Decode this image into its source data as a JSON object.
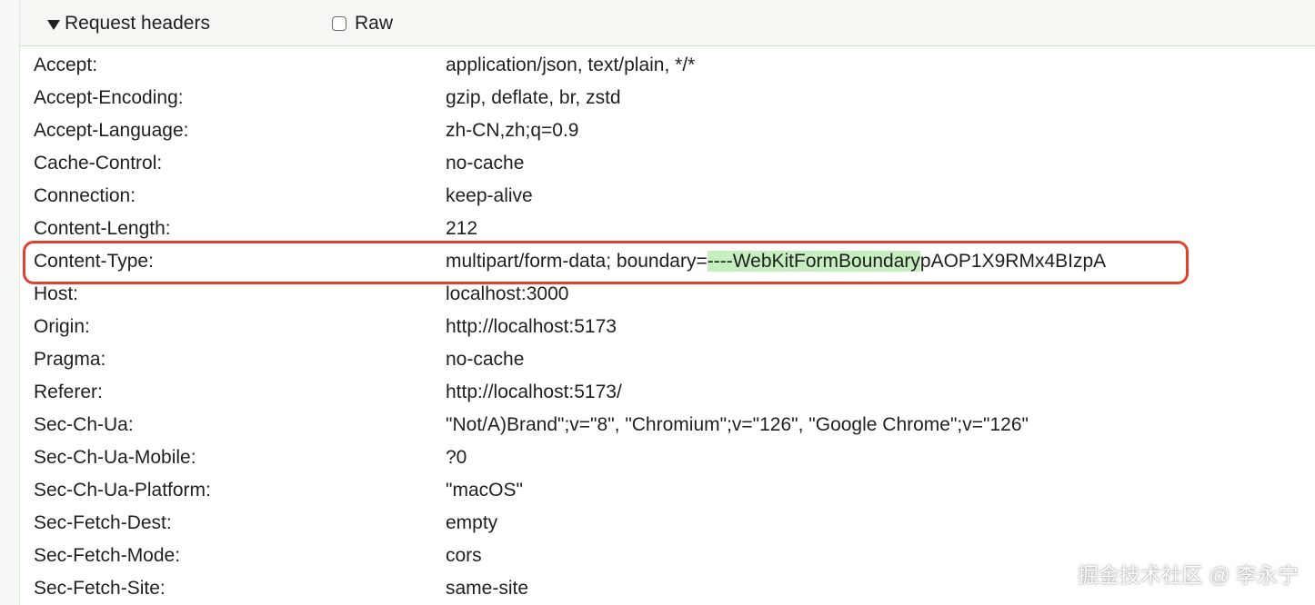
{
  "section": {
    "title": "Request headers",
    "raw_label": "Raw",
    "raw_checked": false
  },
  "headers": [
    {
      "name": "Accept:",
      "value": "application/json, text/plain, */*"
    },
    {
      "name": "Accept-Encoding:",
      "value": "gzip, deflate, br, zstd"
    },
    {
      "name": "Accept-Language:",
      "value": "zh-CN,zh;q=0.9"
    },
    {
      "name": "Cache-Control:",
      "value": "no-cache"
    },
    {
      "name": "Connection:",
      "value": "keep-alive"
    },
    {
      "name": "Content-Length:",
      "value": "212"
    },
    {
      "name": "Content-Type:",
      "value_parts": [
        "multipart/form-data; boundary=",
        "----WebKitFormBoundary",
        "pAOP1X9RMx4BIzpA"
      ]
    },
    {
      "name": "Host:",
      "value": "localhost:3000"
    },
    {
      "name": "Origin:",
      "value": "http://localhost:5173"
    },
    {
      "name": "Pragma:",
      "value": "no-cache"
    },
    {
      "name": "Referer:",
      "value": "http://localhost:5173/"
    },
    {
      "name": "Sec-Ch-Ua:",
      "value": "\"Not/A)Brand\";v=\"8\", \"Chromium\";v=\"126\", \"Google Chrome\";v=\"126\""
    },
    {
      "name": "Sec-Ch-Ua-Mobile:",
      "value": "?0"
    },
    {
      "name": "Sec-Ch-Ua-Platform:",
      "value": "\"macOS\""
    },
    {
      "name": "Sec-Fetch-Dest:",
      "value": "empty"
    },
    {
      "name": "Sec-Fetch-Mode:",
      "value": "cors"
    },
    {
      "name": "Sec-Fetch-Site:",
      "value": "same-site"
    }
  ],
  "watermark": "掘金技术社区 @ 李永宁",
  "colors": {
    "highlight_box": "#e0402e",
    "text_highlight": "#c6efc0",
    "header_bar": "#f4f7f2"
  }
}
